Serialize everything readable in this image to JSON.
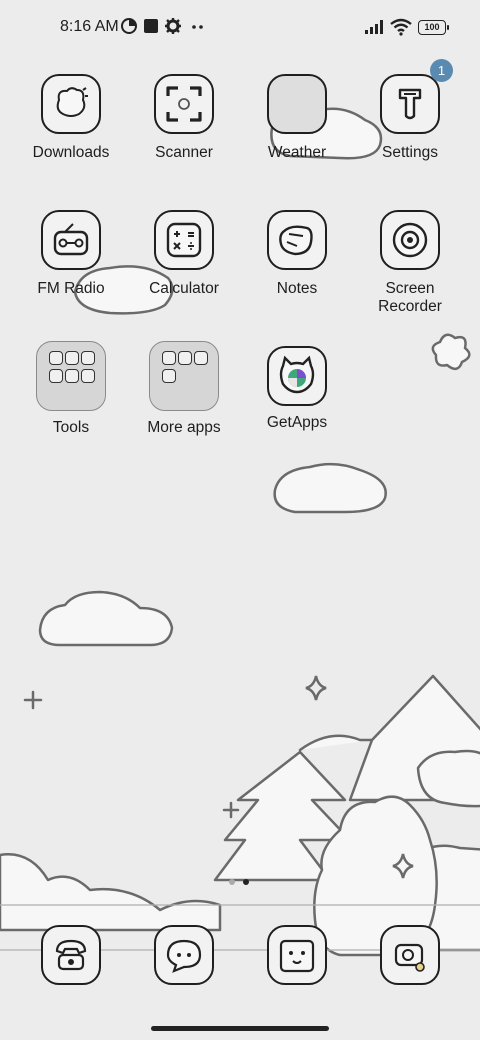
{
  "status_bar": {
    "time": "8:16 AM",
    "notification_icons": [
      "data-saver-icon",
      "square-app-icon",
      "gear-icon",
      "more-dots-icon"
    ],
    "system_icons": [
      "cellular-signal-icon",
      "wifi-icon",
      "battery-icon"
    ],
    "battery_level": "100"
  },
  "apps": [
    {
      "label": "Downloads",
      "icon": "downloads-icon"
    },
    {
      "label": "Scanner",
      "icon": "scanner-icon"
    },
    {
      "label": "Weather",
      "icon": "weather-icon"
    },
    {
      "label": "Settings",
      "icon": "settings-icon",
      "badge": "1"
    },
    {
      "label": "FM Radio",
      "icon": "radio-icon"
    },
    {
      "label": "Calculator",
      "icon": "calculator-icon"
    },
    {
      "label": "Notes",
      "icon": "notes-icon"
    },
    {
      "label": "Screen\nRecorder",
      "icon": "screen-recorder-icon"
    },
    {
      "label": "Tools",
      "icon": "folder-icon"
    },
    {
      "label": "More apps",
      "icon": "folder-icon"
    },
    {
      "label": "GetApps",
      "icon": "getapps-icon"
    }
  ],
  "dock": [
    {
      "icon": "phone-icon"
    },
    {
      "icon": "messages-icon"
    },
    {
      "icon": "camera-icon"
    },
    {
      "icon": "browser-icon"
    }
  ],
  "colors": {
    "background": "#ececec",
    "badge": "#5a8ab0",
    "icon_fill": "#f2f2f2",
    "outline": "#1f1f1f"
  }
}
